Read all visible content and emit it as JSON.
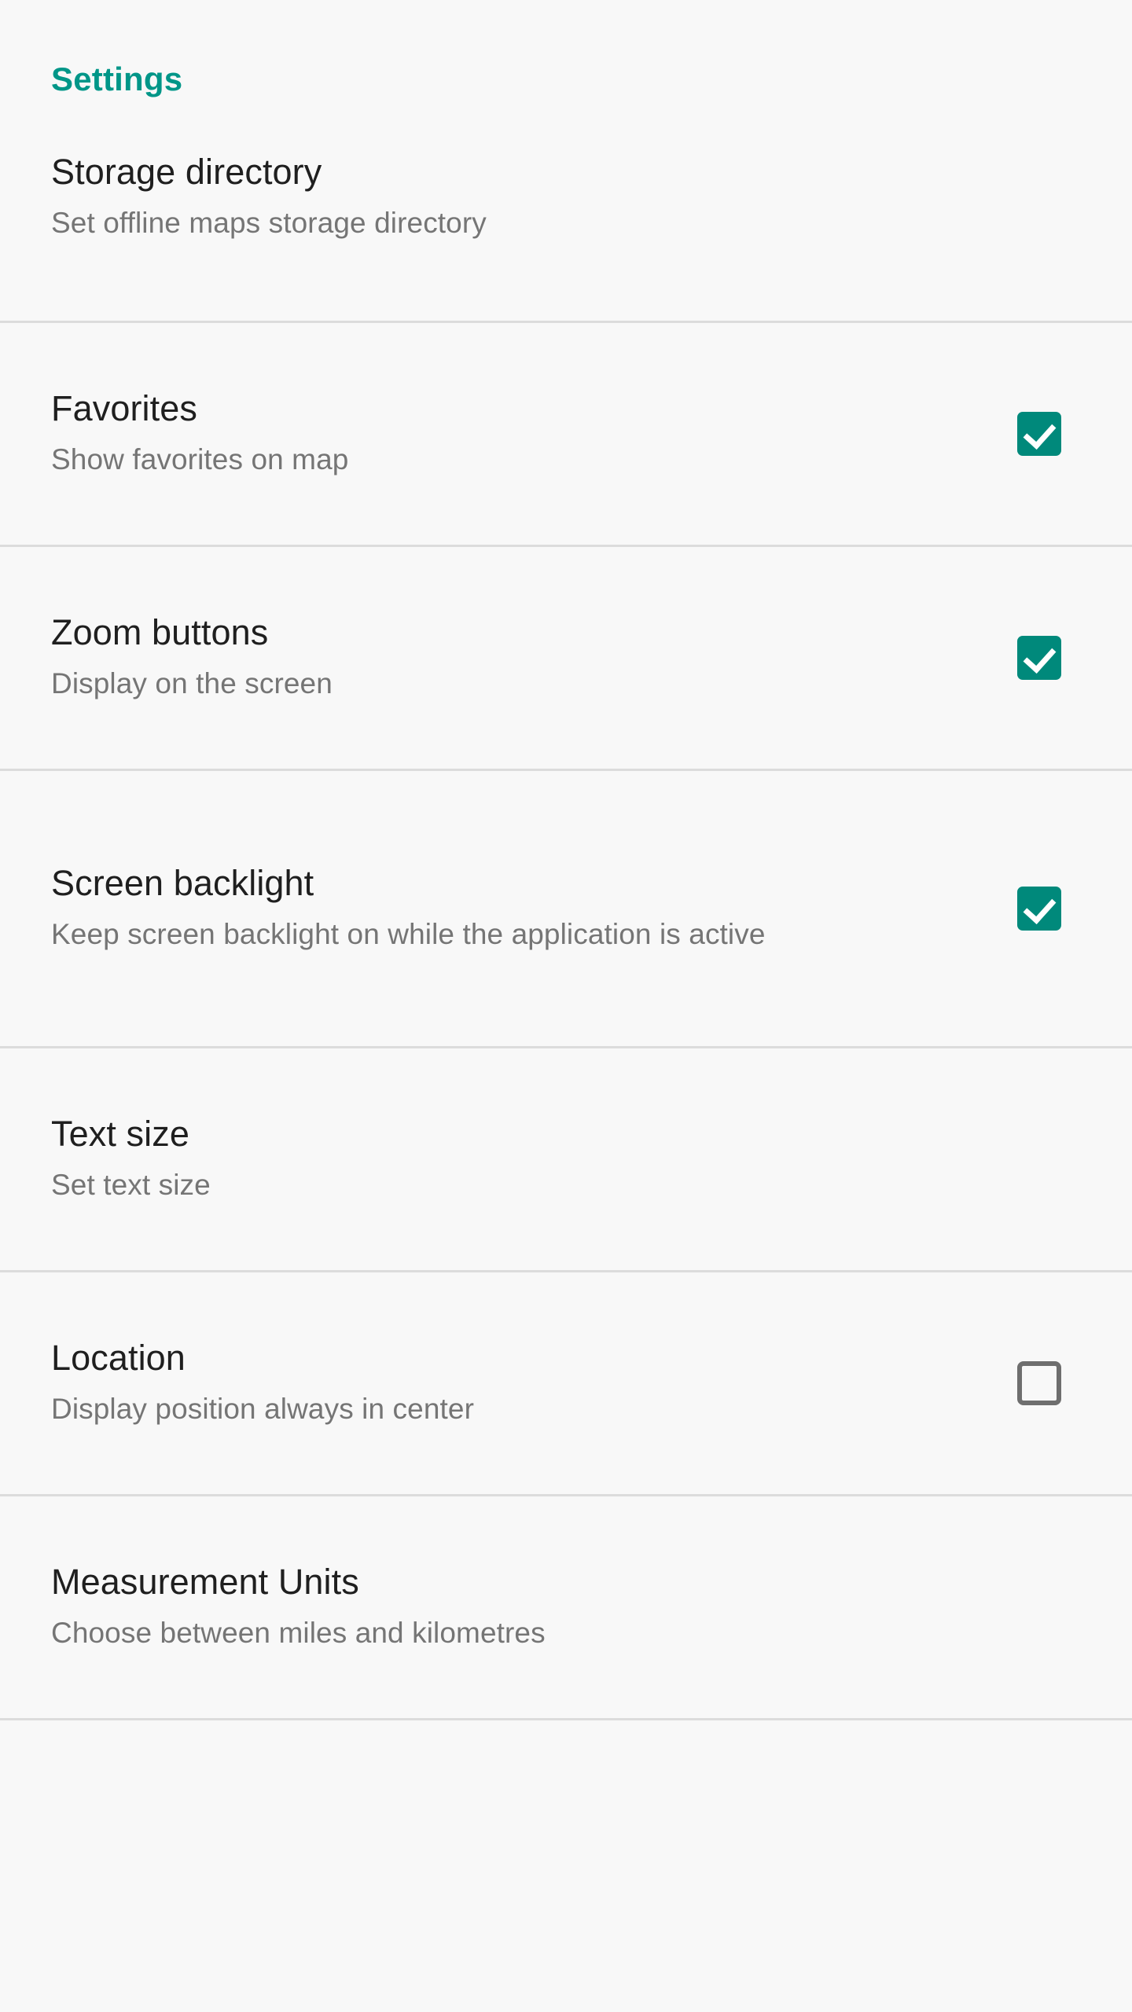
{
  "header": {
    "title": "Settings",
    "accent_color": "#009688"
  },
  "theme": {
    "background": "#f8f8f8",
    "divider_color": "#dcdcdc",
    "title_color": "#1f1f1f",
    "summary_color": "#757575",
    "checkbox_checked_color": "#00897b",
    "checkbox_unchecked_color": "#6e6e6e",
    "checkmark_color": "#ffffff"
  },
  "preferences": [
    {
      "title": "Storage directory",
      "summary": "Set offline maps storage directory",
      "checkbox": "none"
    },
    {
      "title": "Favorites",
      "summary": "Show favorites on map",
      "checkbox": "checked"
    },
    {
      "title": "Zoom buttons",
      "summary": "Display on the screen",
      "checkbox": "checked"
    },
    {
      "title": "Screen backlight",
      "summary": "Keep screen backlight on while the application is active",
      "checkbox": "checked"
    },
    {
      "title": "Text size",
      "summary": "Set text size",
      "checkbox": "none"
    },
    {
      "title": "Location",
      "summary": "Display position always in center",
      "checkbox": "unchecked"
    },
    {
      "title": "Measurement Units",
      "summary": "Choose between miles and kilometres",
      "checkbox": "none"
    }
  ]
}
